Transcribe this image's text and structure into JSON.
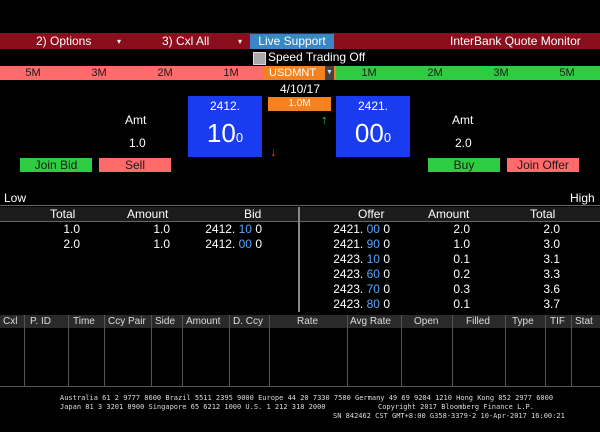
{
  "toolbar": {
    "options_label": "2) Options",
    "cxl_label": "3) Cxl All",
    "live_support": "Live Support",
    "title": "InterBank Quote Monitor",
    "speed_trading": "Speed Trading Off"
  },
  "tenors_left": [
    "5M",
    "3M",
    "2M",
    "1M"
  ],
  "tenors_right": [
    "1M",
    "2M",
    "3M",
    "5M"
  ],
  "pair": "USDMNT",
  "date": "4/10/17",
  "amount_tag": "1.0M",
  "bid": {
    "big": "2412.",
    "pips": "10",
    "frac": "0",
    "amt_label": "Amt",
    "amt": "1.0"
  },
  "offer": {
    "big": "2421.",
    "pips": "00",
    "frac": "0",
    "amt_label": "Amt",
    "amt": "2.0"
  },
  "buttons": {
    "join_bid": "Join Bid",
    "sell": "Sell",
    "buy": "Buy",
    "join_offer": "Join Offer"
  },
  "range": {
    "low": "Low",
    "high": "High"
  },
  "depth_headers": {
    "total_l": "Total",
    "amount_l": "Amount",
    "bid": "Bid",
    "offer": "Offer",
    "amount_r": "Amount",
    "total_r": "Total"
  },
  "bids": [
    {
      "total": "1.0",
      "amount": "1.0",
      "big": "2412.",
      "pip": "10",
      "frac": "0"
    },
    {
      "total": "2.0",
      "amount": "1.0",
      "big": "2412.",
      "pip": "00",
      "frac": "0"
    }
  ],
  "offers": [
    {
      "big": "2421.",
      "pip": "00",
      "frac": "0",
      "amount": "2.0",
      "total": "2.0"
    },
    {
      "big": "2421.",
      "pip": "90",
      "frac": "0",
      "amount": "1.0",
      "total": "3.0"
    },
    {
      "big": "2423.",
      "pip": "10",
      "frac": "0",
      "amount": "0.1",
      "total": "3.1"
    },
    {
      "big": "2423.",
      "pip": "60",
      "frac": "0",
      "amount": "0.2",
      "total": "3.3"
    },
    {
      "big": "2423.",
      "pip": "70",
      "frac": "0",
      "amount": "0.3",
      "total": "3.6"
    },
    {
      "big": "2423.",
      "pip": "80",
      "frac": "0",
      "amount": "0.1",
      "total": "3.7"
    }
  ],
  "order_columns": [
    "Cxl",
    "P. ID",
    "Time",
    "Ccy Pair",
    "Side",
    "Amount",
    "D. Ccy",
    "Rate",
    "Avg Rate",
    "Open",
    "Filled",
    "Type",
    "TIF",
    "Stat"
  ],
  "footer": {
    "line1": "Australia 61 2 9777 8600 Brazil 5511 2395 9000 Europe 44 20 7330 7500 Germany 49 69 9204 1210 Hong Kong 852 2977 6000",
    "line2a": "Japan 81 3 3201 8900        Singapore 65 6212 1000        U.S. 1 212 318 2000",
    "line2b": "Copyright 2017 Bloomberg Finance L.P.",
    "line3": "SN 842462 CST  GMT+8:00 G358-3379-2 10-Apr-2017 16:00:21"
  },
  "colors": {
    "bar_red": "#8b0e1c",
    "tenor_red": "#ff6b6b",
    "tenor_green": "#2ecc40",
    "pair_orange": "#f5821f",
    "quote_blue": "#1a3cf0",
    "pip_blue": "#57a6ff",
    "live_blue": "#3b86c8"
  }
}
